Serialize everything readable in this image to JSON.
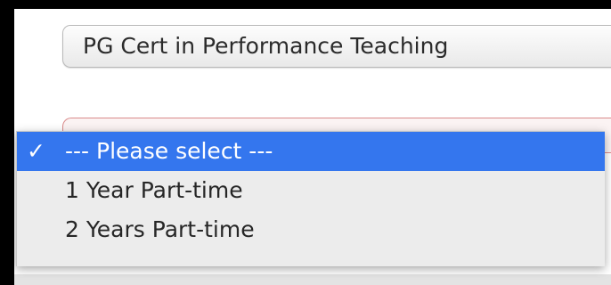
{
  "form": {
    "course_select": {
      "value": "PG Cert in Performance Teaching"
    },
    "study_mode_select": {
      "state": "error",
      "open": true,
      "options": [
        {
          "label": "--- Please select ---",
          "selected": true,
          "check_glyph": "✓"
        },
        {
          "label": "1 Year Part-time",
          "selected": false
        },
        {
          "label": "2 Years Part-time",
          "selected": false
        }
      ]
    }
  },
  "colors": {
    "highlight": "#3476ee",
    "error_border": "#d98a8a",
    "menu_background": "#ececec"
  },
  "icons": {
    "selected_marker": "checkmark-icon"
  }
}
